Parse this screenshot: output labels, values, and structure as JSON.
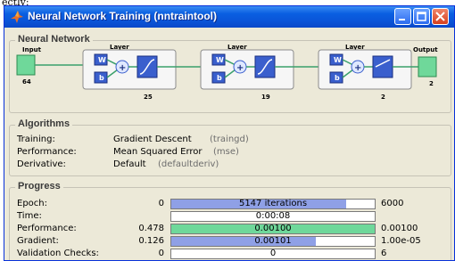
{
  "crop_text": "ectly:",
  "window": {
    "title": "Neural Network Training (nntraintool)",
    "buttons": [
      "minimize",
      "maximize",
      "close"
    ]
  },
  "network": {
    "section_title": "Neural Network",
    "input": {
      "label": "Input",
      "size": "64"
    },
    "output": {
      "label": "Output",
      "size": "2"
    },
    "layers": [
      {
        "title": "Layer",
        "w": "W",
        "b": "b",
        "size": "25"
      },
      {
        "title": "Layer",
        "w": "W",
        "b": "b",
        "size": "19"
      },
      {
        "title": "Layer",
        "w": "W",
        "b": "b",
        "size": "2"
      }
    ]
  },
  "algorithms": {
    "section_title": "Algorithms",
    "rows": [
      {
        "label": "Training:",
        "value": "Gradient Descent",
        "code": "(traingd)"
      },
      {
        "label": "Performance:",
        "value": "Mean Squared Error",
        "code": "(mse)"
      },
      {
        "label": "Derivative:",
        "value": "Default",
        "code": "(defaultderiv)"
      }
    ]
  },
  "progress": {
    "section_title": "Progress",
    "rows": [
      {
        "label": "Epoch:",
        "start": "0",
        "bar_text": "5147 iterations",
        "end": "6000",
        "fill": 0.858,
        "fill_color": "#8fa0e6"
      },
      {
        "label": "Time:",
        "start": "",
        "bar_text": "0:00:08",
        "end": "",
        "fill": 0,
        "fill_color": "#8fa0e6"
      },
      {
        "label": "Performance:",
        "start": "0.478",
        "bar_text": "0.00100",
        "end": "0.00100",
        "fill": 1.0,
        "fill_color": "#6fd89a"
      },
      {
        "label": "Gradient:",
        "start": "0.126",
        "bar_text": "0.00101",
        "end": "1.00e-05",
        "fill": 0.71,
        "fill_color": "#8fa0e6"
      },
      {
        "label": "Validation Checks:",
        "start": "0",
        "bar_text": "0",
        "end": "6",
        "fill": 0,
        "fill_color": "#8fa0e6"
      }
    ]
  }
}
